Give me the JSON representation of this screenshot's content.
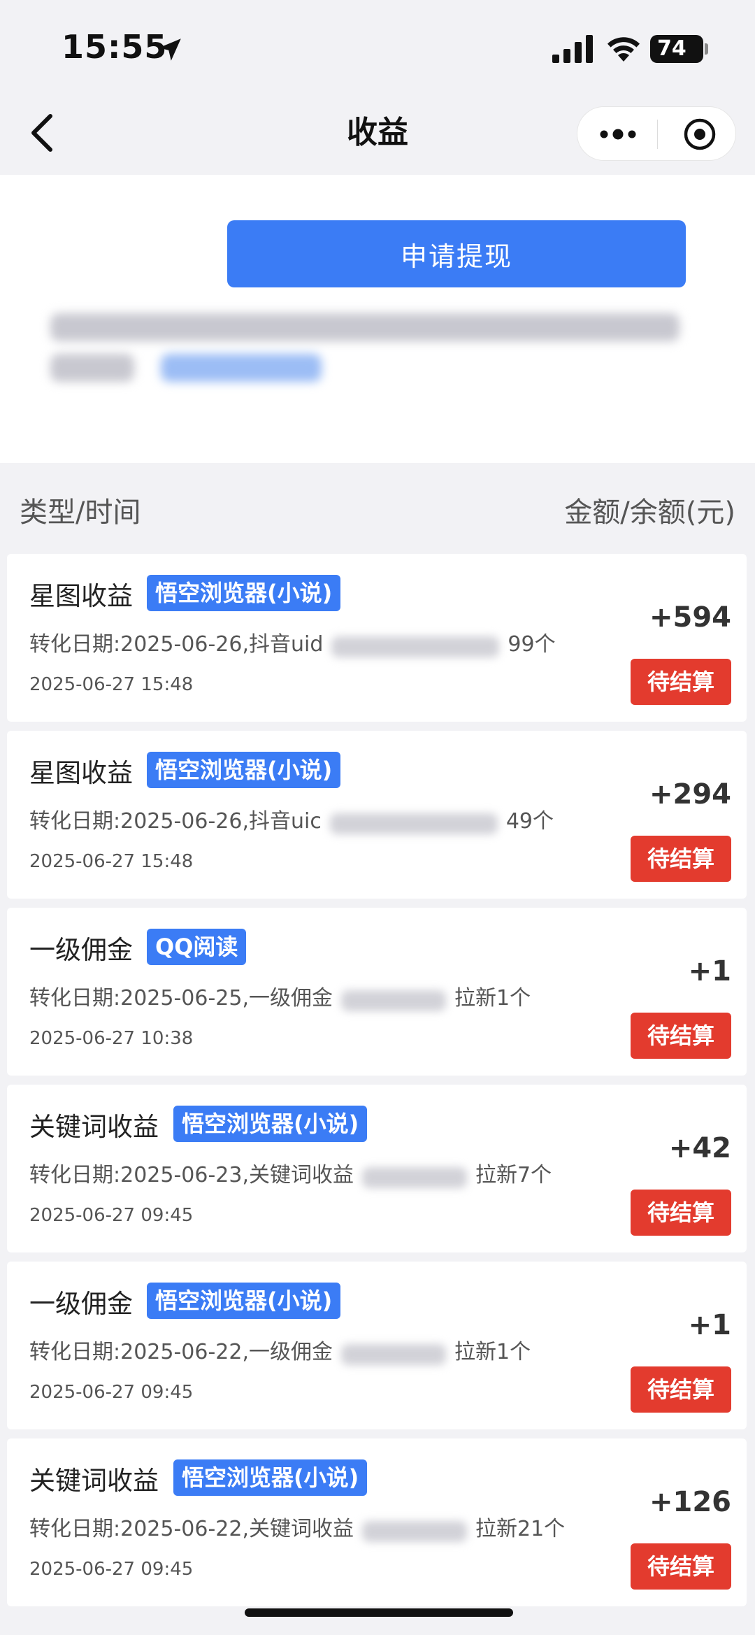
{
  "status_bar": {
    "time": "15:55",
    "battery": "74",
    "icons": [
      "location-arrow-icon",
      "signal-icon",
      "wifi-icon",
      "battery-icon"
    ]
  },
  "nav": {
    "title": "收益",
    "icons": [
      "back-chevron-icon",
      "more-dots-icon",
      "target-icon"
    ]
  },
  "top": {
    "withdraw_label": "申请提现"
  },
  "list_header": {
    "left": "类型/时间",
    "right": "金额/余额(元)"
  },
  "records": [
    {
      "title": "星图收益",
      "tag": "悟空浏览器(小说)",
      "desc_prefix": "转化日期:2025-06-26,抖音uid",
      "desc_suffix": "99个",
      "time": "2025-06-27 15:48",
      "amount": "+594",
      "status": "待结算"
    },
    {
      "title": "星图收益",
      "tag": "悟空浏览器(小说)",
      "desc_prefix": "转化日期:2025-06-26,抖音uic",
      "desc_suffix": "49个",
      "time": "2025-06-27 15:48",
      "amount": "+294",
      "status": "待结算"
    },
    {
      "title": "一级佣金",
      "tag": "QQ阅读",
      "desc_prefix": "转化日期:2025-06-25,一级佣金",
      "desc_suffix": "拉新1个",
      "time": "2025-06-27 10:38",
      "amount": "+1",
      "status": "待结算"
    },
    {
      "title": "关键词收益",
      "tag": "悟空浏览器(小说)",
      "desc_prefix": "转化日期:2025-06-23,关键词收益",
      "desc_suffix": "拉新7个",
      "time": "2025-06-27 09:45",
      "amount": "+42",
      "status": "待结算"
    },
    {
      "title": "一级佣金",
      "tag": "悟空浏览器(小说)",
      "desc_prefix": "转化日期:2025-06-22,一级佣金",
      "desc_suffix": "拉新1个",
      "time": "2025-06-27 09:45",
      "amount": "+1",
      "status": "待结算"
    },
    {
      "title": "关键词收益",
      "tag": "悟空浏览器(小说)",
      "desc_prefix": "转化日期:2025-06-22,关键词收益",
      "desc_suffix": "拉新21个",
      "time": "2025-06-27 09:45",
      "amount": "+126",
      "status": "待结算"
    }
  ],
  "colors": {
    "accent_blue": "#3b7cf5",
    "status_red": "#e33b2e",
    "background": "#f2f2f5"
  }
}
